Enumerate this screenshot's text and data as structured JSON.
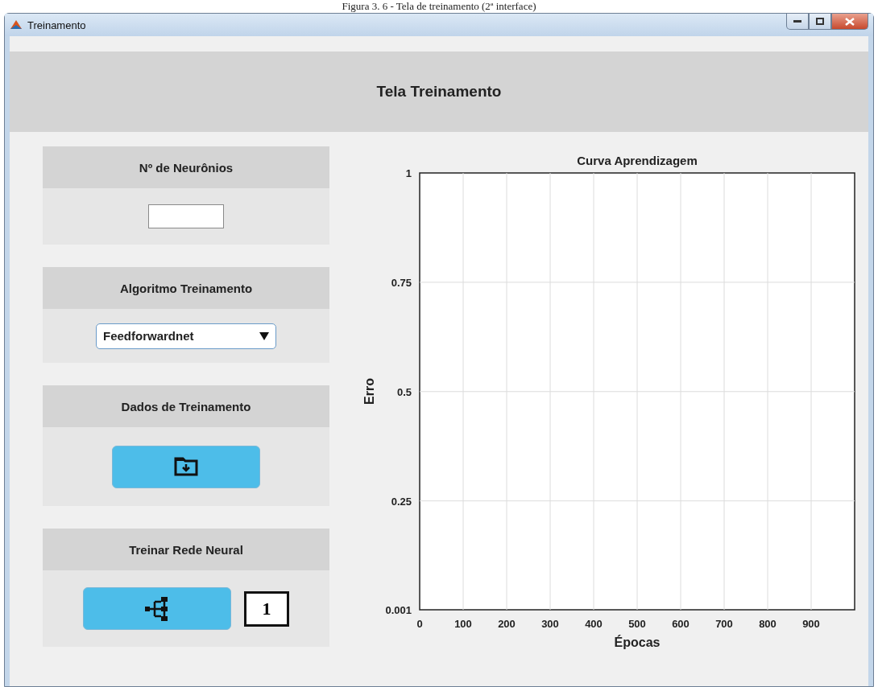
{
  "caption": "Figura 3. 6 - Tela de treinamento (2ª interface)",
  "window": {
    "title": "Treinamento"
  },
  "header": {
    "title": "Tela Treinamento"
  },
  "sections": [
    {
      "kind": "input",
      "title": "Nº de Neurônios"
    },
    {
      "kind": "dropdown",
      "title": "Algoritmo Treinamento",
      "value": "Feedforwardnet"
    },
    {
      "kind": "load",
      "title": "Dados de Treinamento"
    },
    {
      "kind": "train",
      "title": "Treinar Rede Neural",
      "badge": "1"
    }
  ],
  "chart_data": {
    "type": "line",
    "title": "Curva Aprendizagem",
    "xlabel": "Épocas",
    "ylabel": "Erro",
    "xlim": [
      0,
      1000
    ],
    "ylim": [
      0.001,
      1
    ],
    "xticks": [
      0,
      100,
      200,
      300,
      400,
      500,
      600,
      700,
      800,
      900
    ],
    "yticks": [
      0.001,
      0.25,
      0.5,
      0.75,
      1
    ],
    "grid": true
  }
}
